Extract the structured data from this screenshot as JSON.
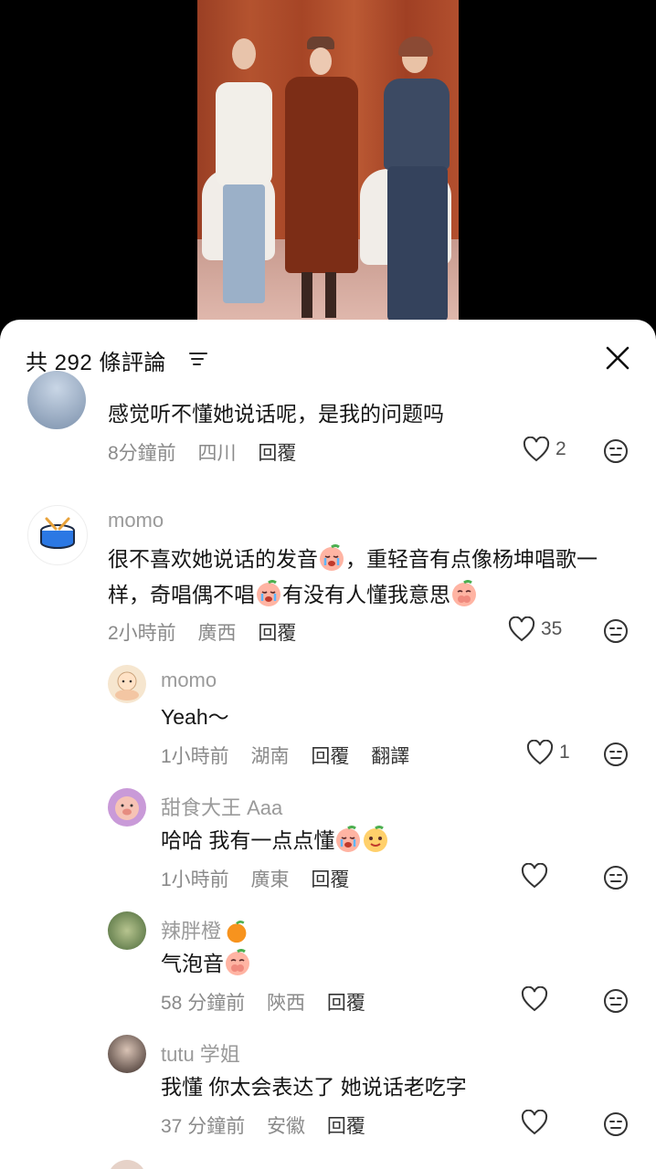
{
  "header": {
    "count_label": "共 292 條評論"
  },
  "comments": [
    {
      "user": "",
      "text": "感觉听不懂她说话呢，是我的问题吗",
      "time": "8分鐘前",
      "location": "四川",
      "reply": "回覆",
      "likes": "2"
    },
    {
      "user": "momo",
      "text_a": "很不喜欢她说话的发音",
      "text_b": "，重轻音有点像杨坤唱歌一样，奇唱偶不唱",
      "text_c": "有没有人懂我意思",
      "time": "2小時前",
      "location": "廣西",
      "reply": "回覆",
      "likes": "35"
    }
  ],
  "replies": [
    {
      "user": "momo",
      "text": "Yeah～",
      "time": "1小時前",
      "location": "湖南",
      "reply": "回覆",
      "translate": "翻譯",
      "likes": "1"
    },
    {
      "user": "甜食大王 Aaa",
      "text": "哈哈 我有一点点懂",
      "time": "1小時前",
      "location": "廣東",
      "reply": "回覆",
      "likes": ""
    },
    {
      "user": "辣胖橙",
      "text": "气泡音",
      "time": "58 分鐘前",
      "location": "陝西",
      "reply": "回覆",
      "likes": ""
    },
    {
      "user": "tutu 学姐",
      "text": "我懂 你太会表达了 她说话老吃字",
      "time": "37 分鐘前",
      "location": "安徽",
      "reply": "回覆",
      "likes": ""
    }
  ],
  "icons": {
    "close": "close-icon",
    "sort": "sort-icon",
    "heart": "heart-icon",
    "dislike": "dislike-face-icon",
    "crying": "crying-peach-emoji",
    "shy": "shy-peach-emoji",
    "orange": "orange-emoji"
  }
}
